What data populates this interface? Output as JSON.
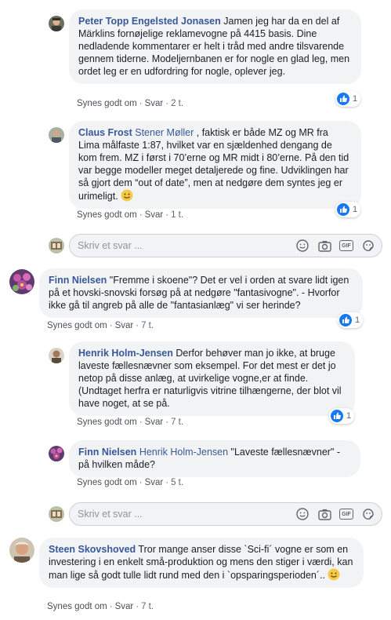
{
  "comments": [
    {
      "author": "Peter Topp Engelsted Jonasen",
      "text": " Jamen jeg har da en del af Märklins fornøjelige reklamevogne på 4415 basis. Dine nedladende kommentarer er helt i tråd med andre tilsvarende gennem tiderne. Modeljernbanen er for nogle en glad leg, men ordet leg er en udfordring for nogle, oplever jeg.",
      "like_label": "Synes godt om",
      "reply_label": "Svar",
      "time": "2 t.",
      "reactions": "1"
    },
    {
      "author": "Claus Frost",
      "mention": "Stener Møller",
      "text": " , faktisk er både MZ og MR fra Lima målfaste 1:87, hvilket var en sjældenhed dengang de kom frem. MZ i først i 70’erne og MR midt i 80’erne. På den tid var begge modeller meget detaljerede og fine. Udviklingen har så gjort dem “out of date”, men at nedgøre dem syntes jeg er urimeligt.",
      "like_label": "Synes godt om",
      "reply_label": "Svar",
      "time": "1 t.",
      "reactions": "1"
    },
    {
      "author": "Finn Nielsen",
      "text": " \"Fremme i skoene\"? Det er vel i orden at svare lidt igen på et hovski-snovski forsøg på at nedgøre \"fantasivogne\". - Hvorfor ikke gå til angreb på alle de \"fantasianlæg\" vi ser herinde?",
      "like_label": "Synes godt om",
      "reply_label": "Svar",
      "time": "7 t.",
      "reactions": "1"
    },
    {
      "author": "Henrik Holm-Jensen",
      "text": " Derfor behøver man jo ikke, at bruge laveste fællesnævner som eksempel. For det mest er det jo netop på disse anlæg, at uvirkelige vogne,er at finde. (Undtaget herfra er naturligvis vitrine tilhængerne, der blot vil have noget, at se på.",
      "like_label": "Synes godt om",
      "reply_label": "Svar",
      "time": "7 t.",
      "reactions": "1"
    },
    {
      "author": "Finn Nielsen",
      "mention": "Henrik Holm-Jensen",
      "text": " \"Laveste fællesnævner\" - på hvilken måde?",
      "like_label": "Synes godt om",
      "reply_label": "Svar",
      "time": "5 t."
    },
    {
      "author": "Steen Skovshoved",
      "text": " Tror mange anser disse `Sci-fi´ vogne er som en investering i en enkelt små-produktion og mens den stiger i værdi, kan man lige så godt tulle lidt rund med den i `opsparingsperioden´..",
      "like_label": "Synes godt om",
      "reply_label": "Svar",
      "time": "7 t."
    }
  ],
  "reply_boxes": [
    {
      "placeholder": "Skriv et svar ..."
    },
    {
      "placeholder": "Skriv et svar ..."
    }
  ],
  "icons": {
    "emoji": "emoji-icon",
    "camera": "camera-icon",
    "gif": "GIF",
    "sticker": "sticker-icon"
  },
  "colors": {
    "author": "#385898",
    "bubble": "#f2f3f5",
    "like_blue": "#1877f2",
    "meta": "#606770"
  }
}
